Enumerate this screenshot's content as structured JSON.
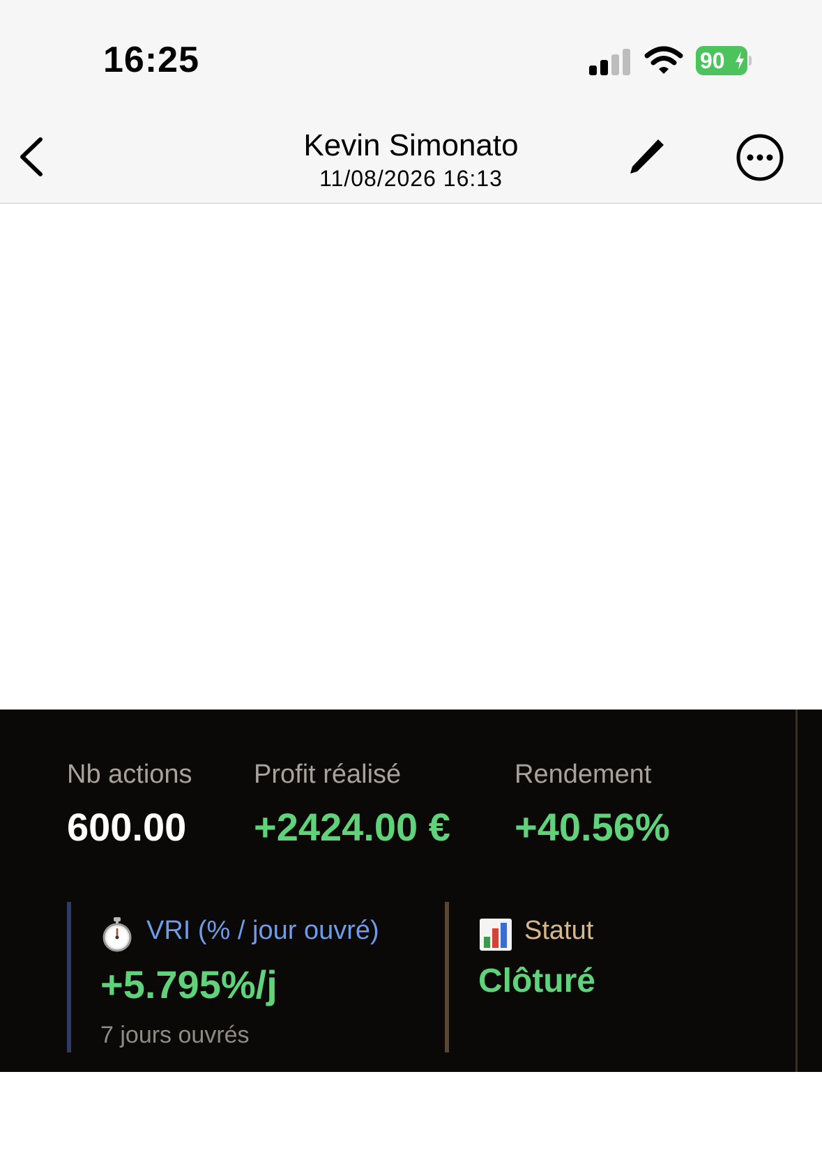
{
  "status_bar": {
    "time": "16:25",
    "battery_level": "90",
    "signal_icon": "cellular-signal-icon",
    "wifi_icon": "wifi-icon",
    "battery_icon": "battery-charging-icon"
  },
  "nav": {
    "title": "Kevin Simonato",
    "subtitle": "11/08/2026 16:13",
    "back_icon": "chevron-left-icon",
    "edit_icon": "pencil-icon",
    "more_icon": "more-icon"
  },
  "metrics": [
    {
      "label": "Nb actions",
      "value": "600.00"
    },
    {
      "label": "Profit réalisé",
      "value": "+2424.00 €"
    },
    {
      "label": "Rendement",
      "value": "+40.56%"
    }
  ],
  "vri": {
    "icon": "stopwatch-icon",
    "label": "VRI (% / jour ouvré)",
    "value": "+5.795%/j",
    "sub": "7 jours ouvrés"
  },
  "statut": {
    "icon": "bar-chart-icon",
    "label": "Statut",
    "value": "Clôturé"
  },
  "colors": {
    "positive": "#5fd27a",
    "panel_bg": "#0a0908",
    "vri_accent": "#6f9be8",
    "statut_accent": "#d6b98a"
  }
}
